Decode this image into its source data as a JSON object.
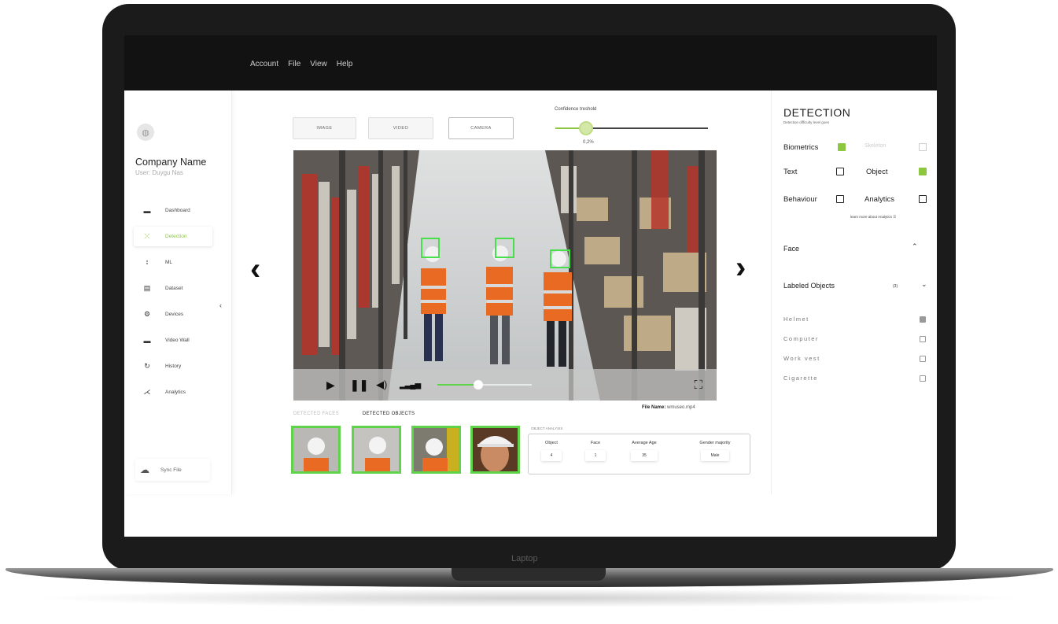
{
  "menu": [
    "Account",
    "File",
    "View",
    "Help"
  ],
  "laptop_label": "Laptop",
  "sidebar": {
    "company": "Company Name",
    "user": "User: Duygu Nas",
    "items": [
      {
        "label": "Dashboard",
        "icon": "dashboard-icon",
        "glyph": "▬"
      },
      {
        "label": "Detection",
        "icon": "detection-icon",
        "glyph": "⤫",
        "active": true
      },
      {
        "label": "ML",
        "icon": "ml-icon",
        "glyph": "⦂"
      },
      {
        "label": "Dataset",
        "icon": "dataset-icon",
        "glyph": "▤"
      },
      {
        "label": "Devices",
        "icon": "devices-icon",
        "glyph": "⚙"
      },
      {
        "label": "Video Wall",
        "icon": "video-wall-icon",
        "glyph": "▬"
      },
      {
        "label": "History",
        "icon": "history-icon",
        "glyph": "↻"
      },
      {
        "label": "Analytics",
        "icon": "analytics-icon",
        "glyph": "⋌"
      }
    ],
    "sync": "Sync File"
  },
  "modes": [
    "IMAGE",
    "VIDEO",
    "CAMERA"
  ],
  "confidence": {
    "title": "Confidence treshold",
    "value": 0.2,
    "label": "0,2%"
  },
  "player": {
    "progress": 0.43
  },
  "file": {
    "label": "File Name:",
    "name": "wmuseo.mp4"
  },
  "result_tabs": {
    "faces": "DETECTED FACES",
    "objects": "DETECTED OBJECTS"
  },
  "stats": {
    "caption": "OBJECT ANALYSIS",
    "columns": [
      {
        "label": "Object",
        "value": "4"
      },
      {
        "label": "Face",
        "value": "1"
      },
      {
        "label": "Average Age",
        "value": "35"
      },
      {
        "label": "Gender majority",
        "value": "Male"
      }
    ]
  },
  "detection": {
    "title": "DETECTION",
    "subtitle": "Detection difficulty level goes",
    "options": [
      {
        "label": "Biometrics",
        "checked": true
      },
      {
        "label": "Skeleton",
        "checked": false,
        "faded": true
      },
      {
        "label": "Text",
        "checked": false
      },
      {
        "label": "Object",
        "checked": true
      },
      {
        "label": "Behaviour",
        "checked": false
      },
      {
        "label": "Analytics",
        "checked": false
      }
    ],
    "learn_more": "learn more about Analytics",
    "face_section": "Face",
    "labeled_section": "Labeled Objects",
    "labeled_count": "(3)",
    "labeled": [
      {
        "label": "Helmet",
        "checked": true
      },
      {
        "label": "Computer",
        "checked": false
      },
      {
        "label": "Work vest",
        "checked": false
      },
      {
        "label": "Cigarette",
        "checked": false
      }
    ]
  }
}
